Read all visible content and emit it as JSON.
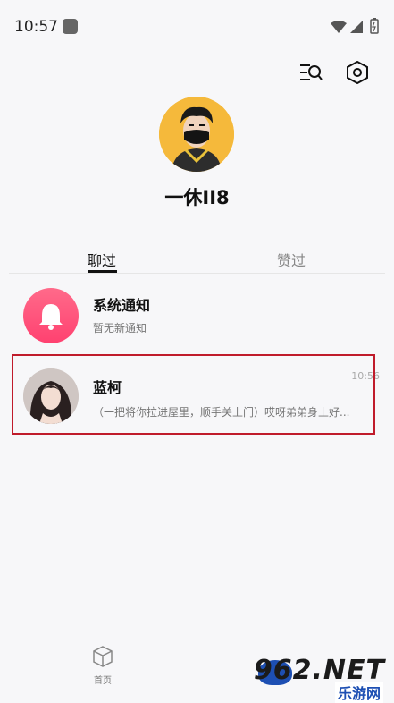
{
  "status_bar": {
    "time": "10:57"
  },
  "profile": {
    "username": "一休II8"
  },
  "tabs": [
    {
      "label": "聊过",
      "active": true
    },
    {
      "label": "赞过",
      "active": false
    }
  ],
  "messages": [
    {
      "title": "系统通知",
      "preview": "暂无新通知",
      "time": ""
    },
    {
      "title": "蓝柯",
      "preview": "（一把将你拉进屋里，顺手关上门）哎呀弟弟身上好...",
      "time": "10:56"
    }
  ],
  "bottom_nav": {
    "home_label": "首页"
  },
  "watermark": {
    "main": "962.NET",
    "sub": "乐游网"
  },
  "colors": {
    "accent": "#ff4170",
    "highlight": "#c01b2b",
    "avatar_bg": "#f5b93b"
  }
}
